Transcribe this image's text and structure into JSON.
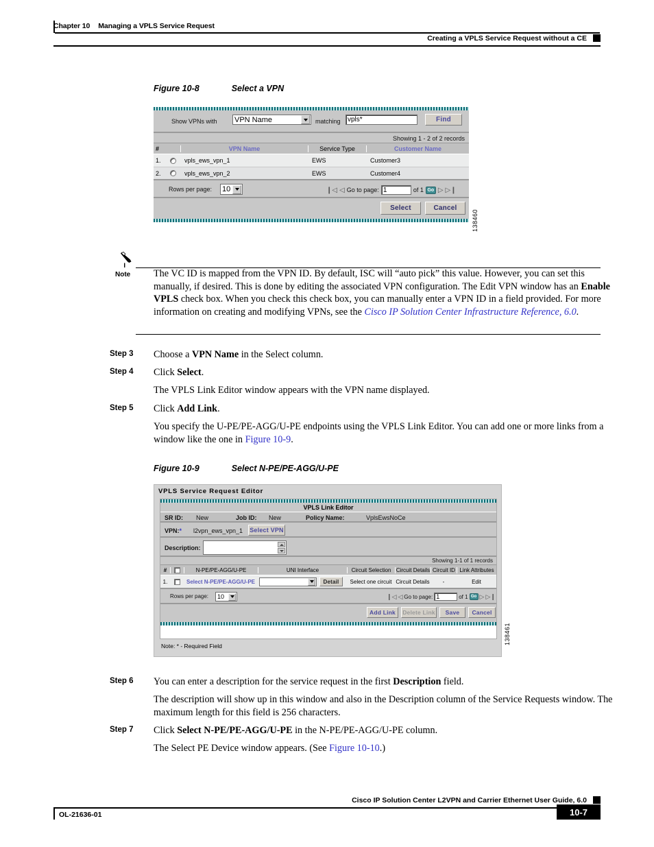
{
  "header": {
    "chapter_num": "Chapter 10",
    "chapter_title": "Managing a VPLS Service Request",
    "section_title": "Creating a VPLS Service Request without a CE"
  },
  "figure1": {
    "caption_label": "Figure 10-8",
    "caption_title": "Select a VPN",
    "figure_id": "138460",
    "search": {
      "show_label": "Show VPNs with",
      "criteria_selected": "VPN Name",
      "matching_label": "matching",
      "match_value": "vpls*",
      "find_label": "Find"
    },
    "records_text": "Showing 1 - 2 of 2 records",
    "columns": [
      "#",
      "",
      "VPN Name",
      "Service Type",
      "Customer Name"
    ],
    "rows": [
      {
        "num": "1.",
        "vpn_name": "vpls_ews_vpn_1",
        "service_type": "EWS",
        "customer_name": "Customer3"
      },
      {
        "num": "2.",
        "vpn_name": "vpls_ews_vpn_2",
        "service_type": "EWS",
        "customer_name": "Customer4"
      }
    ],
    "pager": {
      "rows_per_page_label": "Rows per page:",
      "rows_per_page_value": "10",
      "goto_label": "Go to page:",
      "page_value": "1",
      "of_label": "of 1",
      "go_label": "Go"
    },
    "buttons": {
      "select": "Select",
      "cancel": "Cancel"
    }
  },
  "note": {
    "label": "Note",
    "text_1": "The VC ID is mapped from the VPN ID. By default, ISC will “auto pick” this value. However, you can set this manually, if desired. This is done by editing the associated VPN configuration. The Edit VPN window has an ",
    "bold_1": "Enable VPLS",
    "text_2": " check box. When you check this check box, you can manually enter a VPN ID in a field provided. For more information on creating and modifying VPNs, see the ",
    "link_1": "Cisco IP Solution Center Infrastructure Reference, 6.0",
    "text_3": "."
  },
  "steps": {
    "step3": {
      "num": "Step 3",
      "t1": "Choose a ",
      "b1": "VPN Name",
      "t2": " in the Select column."
    },
    "step4": {
      "num": "Step 4",
      "t1": "Click ",
      "b1": "Select",
      "t2": ".",
      "follow": "The VPLS Link Editor window appears with the VPN name displayed."
    },
    "step5": {
      "num": "Step 5",
      "t1": "Click ",
      "b1": "Add Link",
      "t2": ".",
      "follow_1": "You specify the U-PE/PE-AGG/U-PE endpoints using the VPLS Link Editor. You can add one or more links from a window like the one in ",
      "follow_link": "Figure 10-9",
      "follow_2": "."
    },
    "step6": {
      "num": "Step 6",
      "t1": "You can enter a description for the service request in the first ",
      "b1": "Description",
      "t2": " field.",
      "follow": "The description will show up in this window and also in the Description column of the Service Requests window. The maximum length for this field is 256 characters."
    },
    "step7": {
      "num": "Step 7",
      "t1": "Click ",
      "b1": "Select N-PE/PE-AGG/U-PE",
      "t2": " in the N-PE/PE-AGG/U-PE column.",
      "follow_1": "The Select PE Device window appears. (See ",
      "follow_link": "Figure 10-10",
      "follow_2": ".)"
    }
  },
  "figure2": {
    "caption_label": "Figure 10-9",
    "caption_title": "Select N-PE/PE-AGG/U-PE",
    "figure_id": "138461",
    "window_title": "VPLS Service Request Editor",
    "panel_title": "VPLS Link Editor",
    "meta": {
      "sr_id_label": "SR ID:",
      "sr_id_value": "New",
      "job_id_label": "Job ID:",
      "job_id_value": "New",
      "policy_label": "Policy Name:",
      "policy_value": "VplsEwsNoCe"
    },
    "vpn": {
      "label": "VPN:",
      "required_mark": "*",
      "value": "l2vpn_ews_vpn_1",
      "select_vpn_button": "Select VPN"
    },
    "description": {
      "label": "Description:",
      "value": ""
    },
    "records_text": "Showing 1-1 of 1 records",
    "columns": [
      "#",
      "",
      "N-PE/PE-AGG/U-PE",
      "UNI Interface",
      "Circuit Selection",
      "Circuit Details",
      "Circuit ID",
      "Link Attributes"
    ],
    "row": {
      "num": "1.",
      "npe_link": "Select N-PE/PE-AGG/U-PE",
      "uni_value": "",
      "detail_button": "Detail",
      "circuit_selection": "Select one circuit",
      "circuit_details": "Circuit Details",
      "circuit_id": "-",
      "link_attributes": "Edit"
    },
    "pager": {
      "rows_per_page_label": "Rows per page:",
      "rows_per_page_value": "10",
      "goto_label": "Go to page:",
      "page_value": "1",
      "of_label": "of 1",
      "go_label": "Go"
    },
    "buttons": {
      "add_link": "Add Link",
      "delete_link": "Delete Link",
      "save": "Save",
      "cancel": "Cancel"
    },
    "required_note": "Note: * - Required Field"
  },
  "footer": {
    "guide_title": "Cisco IP Solution Center L2VPN and Carrier Ethernet User Guide, 6.0",
    "doc_id": "OL-21636-01",
    "page_number": "10-7"
  }
}
